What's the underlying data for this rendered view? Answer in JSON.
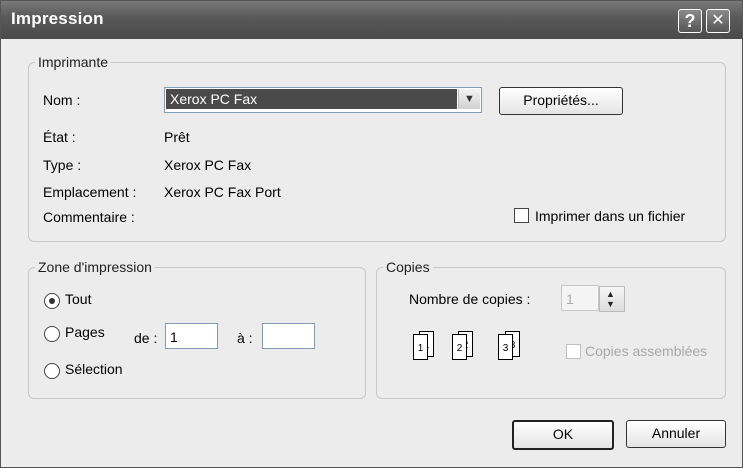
{
  "window": {
    "title": "Impression",
    "help_button": "?",
    "close_button": "✕"
  },
  "printer": {
    "group_label": "Imprimante",
    "name_label": "Nom :",
    "name_value": "Xerox PC Fax",
    "properties_button": "Propriétés...",
    "status_label": "État :",
    "status_value": "Prêt",
    "type_label": "Type :",
    "type_value": "Xerox PC Fax",
    "location_label": "Emplacement :",
    "location_value": "Xerox PC Fax Port",
    "comment_label": "Commentaire :",
    "print_to_file_label": "Imprimer dans un fichier",
    "print_to_file_checked": false
  },
  "range": {
    "group_label": "Zone d'impression",
    "all_label": "Tout",
    "all_selected": true,
    "pages_label": "Pages",
    "from_label": "de :",
    "from_value": "1",
    "to_label": "à :",
    "to_value": "",
    "selection_label": "Sélection"
  },
  "copies": {
    "group_label": "Copies",
    "count_label": "Nombre de copies :",
    "count_value": "1",
    "collate_label": "Copies assemblées",
    "collate_checked": false,
    "page_numbers": [
      "1",
      "1",
      "2",
      "2",
      "3",
      "3"
    ]
  },
  "actions": {
    "ok_label": "OK",
    "cancel_label": "Annuler"
  },
  "icons": {
    "dropdown": "chevron-down-icon",
    "spin_up": "spin-up-icon",
    "spin_down": "spin-down-icon"
  }
}
